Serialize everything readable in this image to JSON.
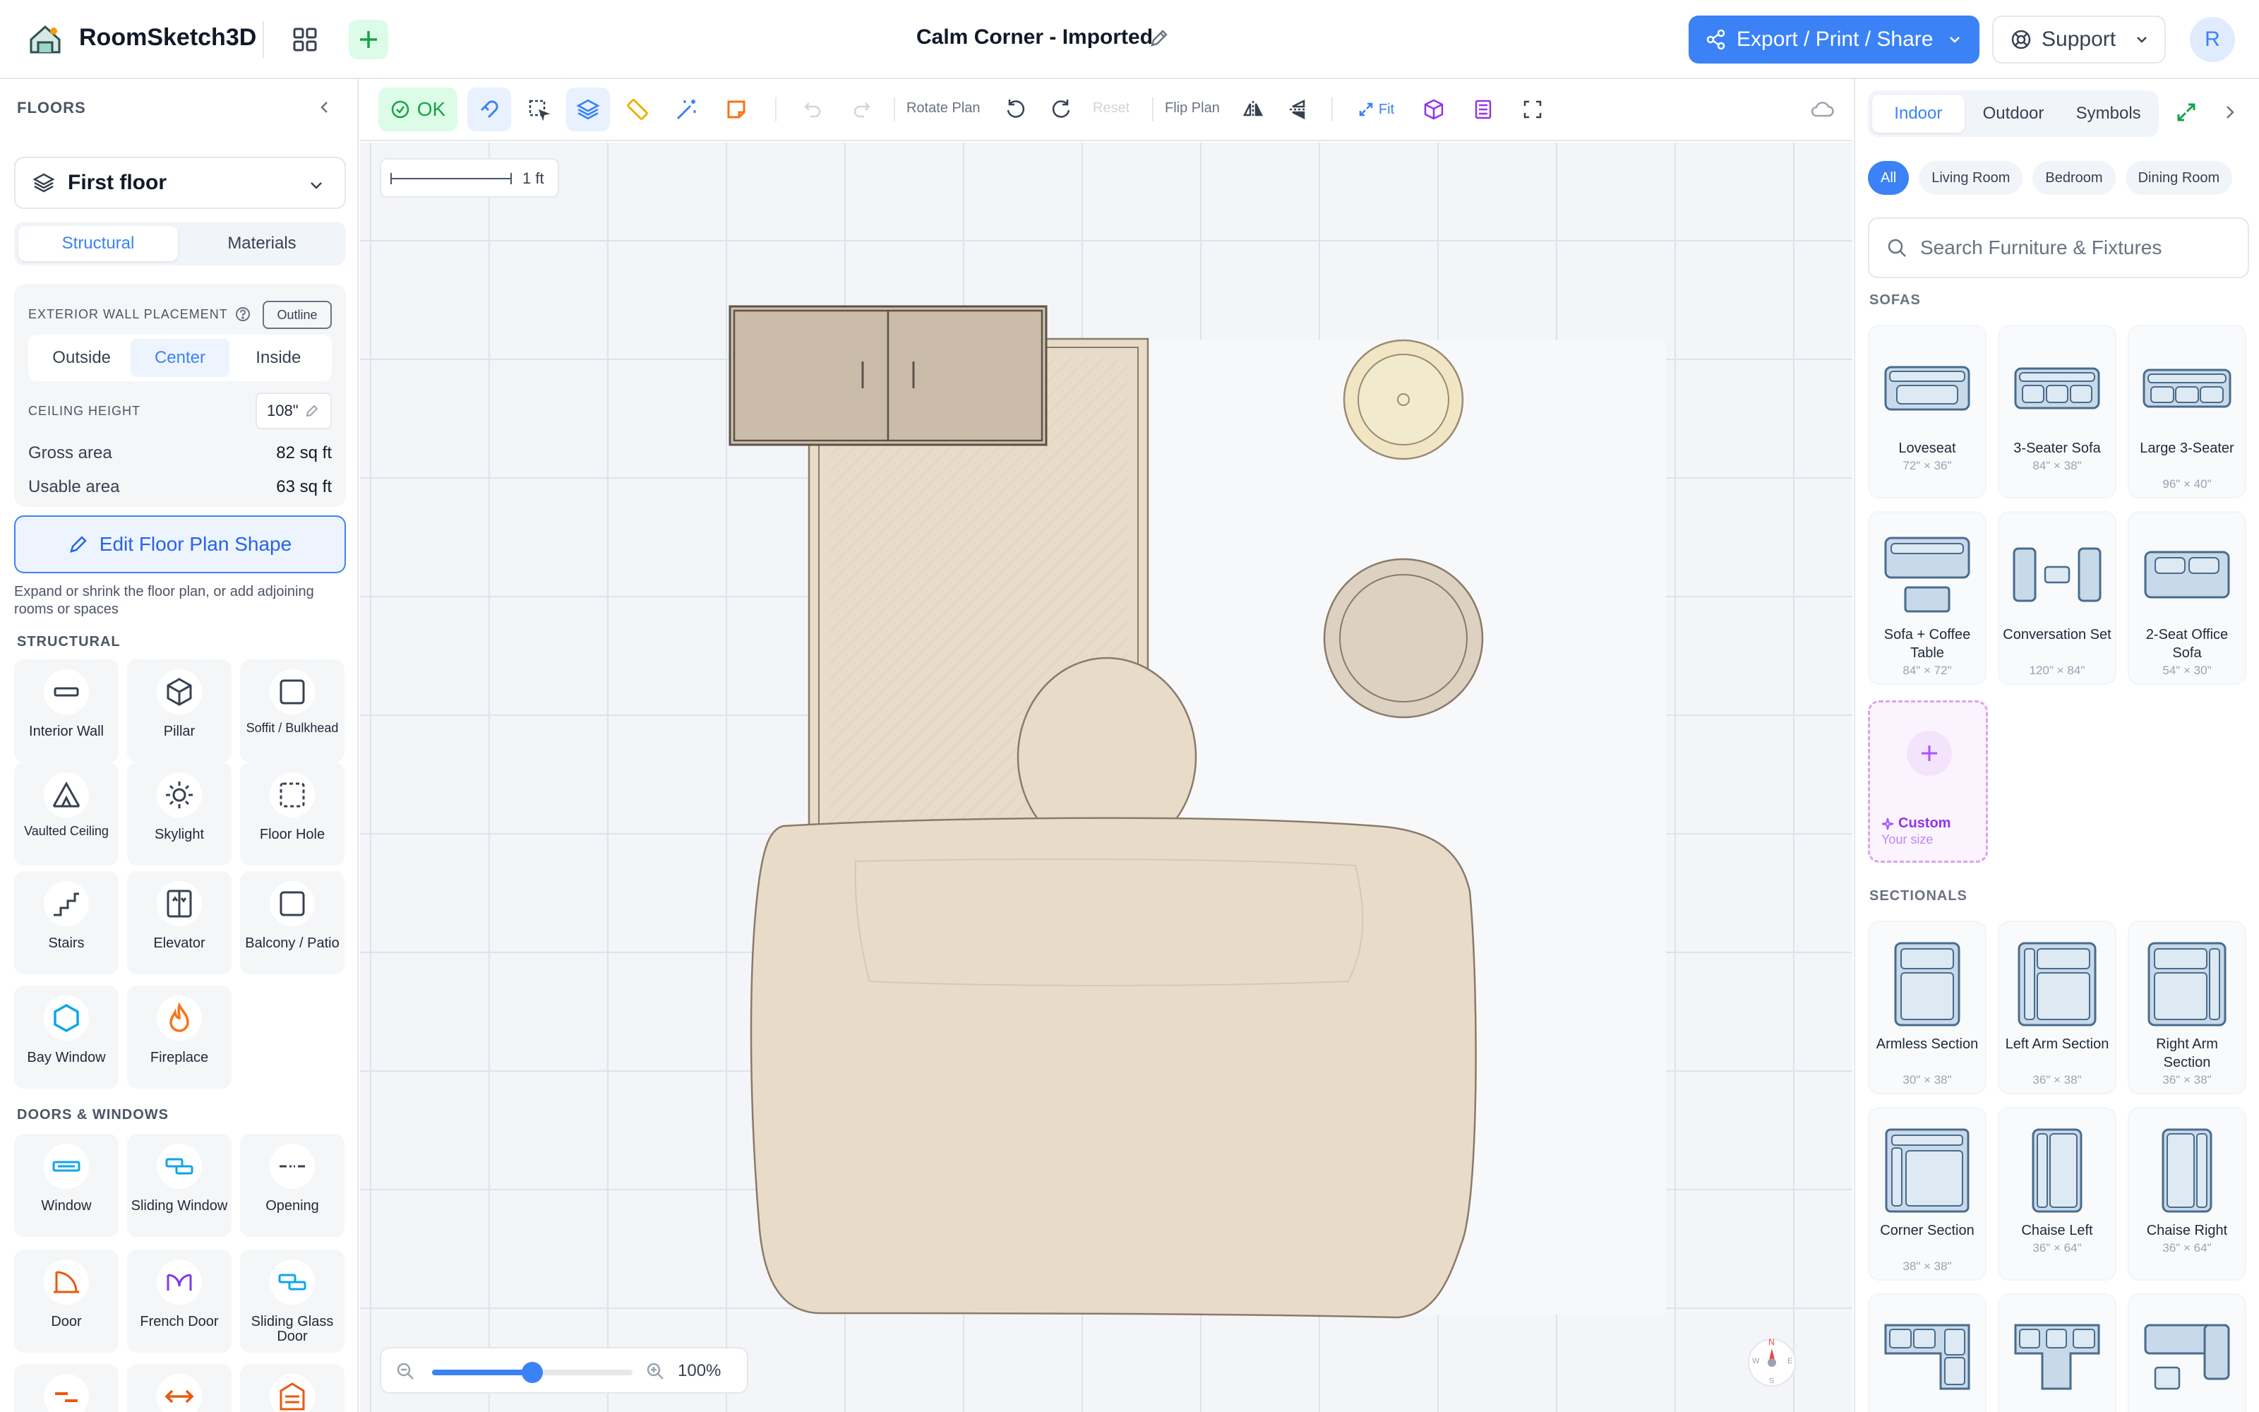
{
  "app": {
    "name": "RoomSketch3D",
    "logo_icon": "house-logo-icon",
    "grid_icon": "grid-icon",
    "add_icon": "plus-icon"
  },
  "document": {
    "title": "Calm Corner - Imported",
    "edit_icon": "pencil-icon"
  },
  "header": {
    "export_label": "Export / Print / Share",
    "support_label": "Support",
    "avatar_initial": "R"
  },
  "left_panel": {
    "heading": "FLOORS",
    "floor_selected": "First floor",
    "tabs": [
      "Structural",
      "Materials"
    ],
    "active_tab": "Structural",
    "wall_placement": {
      "label": "EXTERIOR WALL PLACEMENT",
      "outline_label": "Outline",
      "options": [
        "Outside",
        "Center",
        "Inside"
      ],
      "active": "Center"
    },
    "ceiling": {
      "label": "CEILING HEIGHT",
      "value": "108\""
    },
    "areas": [
      {
        "label": "Gross area",
        "value": "82 sq ft"
      },
      {
        "label": "Usable area",
        "value": "63 sq ft"
      }
    ],
    "edit_button": "Edit Floor Plan Shape",
    "edit_hint": "Expand or shrink the floor plan, or add adjoining rooms or spaces",
    "structural_heading": "STRUCTURAL",
    "structural_items": [
      {
        "label": "Interior Wall",
        "icon": "interior-wall-icon"
      },
      {
        "label": "Pillar",
        "icon": "pillar-icon"
      },
      {
        "label": "Soffit / Bulkhead",
        "icon": "soffit-icon"
      },
      {
        "label": "Vaulted Ceiling",
        "icon": "vaulted-ceiling-icon"
      },
      {
        "label": "Skylight",
        "icon": "skylight-icon"
      },
      {
        "label": "Floor Hole",
        "icon": "floor-hole-icon"
      },
      {
        "label": "Stairs",
        "icon": "stairs-icon"
      },
      {
        "label": "Elevator",
        "icon": "elevator-icon"
      },
      {
        "label": "Balcony / Patio",
        "icon": "balcony-icon"
      },
      {
        "label": "Bay Window",
        "icon": "bay-window-icon"
      },
      {
        "label": "Fireplace",
        "icon": "fireplace-icon"
      }
    ],
    "doors_heading": "DOORS & WINDOWS",
    "door_items": [
      {
        "label": "Window",
        "icon": "window-icon"
      },
      {
        "label": "Sliding Window",
        "icon": "sliding-window-icon"
      },
      {
        "label": "Opening",
        "icon": "opening-icon"
      },
      {
        "label": "Door",
        "icon": "door-icon"
      },
      {
        "label": "French Door",
        "icon": "french-door-icon"
      },
      {
        "label": "Sliding Glass Door",
        "icon": "sliding-glass-door-icon"
      }
    ]
  },
  "toolbar": {
    "ok_label": "OK",
    "rotate_label": "Rotate Plan",
    "reset_label": "Reset",
    "flip_label": "Flip Plan",
    "fit_label": "Fit"
  },
  "canvas": {
    "scale_label": "1 ft",
    "zoom_label": "100%",
    "zoom_fraction": 0.5,
    "compass_labels": {
      "n": "N",
      "e": "E",
      "s": "S",
      "w": "W"
    }
  },
  "right_panel": {
    "tabs": [
      "Indoor",
      "Outdoor",
      "Symbols"
    ],
    "active_tab": "Indoor",
    "chips": [
      "All",
      "Living Room",
      "Bedroom",
      "Dining Room"
    ],
    "active_chip": "All",
    "search_placeholder": "Search Furniture & Fixtures",
    "sofas_heading": "SOFAS",
    "sofas": [
      {
        "name": "Loveseat",
        "size": "72\" × 36\""
      },
      {
        "name": "3-Seater Sofa",
        "size": "84\" × 38\""
      },
      {
        "name": "Large 3-Seater",
        "size": "96\" × 40\""
      },
      {
        "name": "Sofa + Coffee Table",
        "size": "84\" × 72\""
      },
      {
        "name": "Conversation Set",
        "size": "120\" × 84\""
      },
      {
        "name": "2-Seat Office Sofa",
        "size": "54\" × 30\""
      }
    ],
    "custom": {
      "name": "Custom",
      "sub": "Your size"
    },
    "sectionals_heading": "SECTIONALS",
    "sectionals": [
      {
        "name": "Armless Section",
        "size": "30\" × 38\""
      },
      {
        "name": "Left Arm Section",
        "size": "36\" × 38\""
      },
      {
        "name": "Right Arm Section",
        "size": "36\" × 38\""
      },
      {
        "name": "Corner Section",
        "size": "38\" × 38\""
      },
      {
        "name": "Chaise Left",
        "size": "36\" × 64\""
      },
      {
        "name": "Chaise Right",
        "size": "36\" × 64\""
      }
    ]
  },
  "colors": {
    "accent": "#3b82f6",
    "ok_green": "#16a34a",
    "canvas_bg": "#f3f5f8",
    "room_fill": "#e8dcc9",
    "wall": "#8b7a6a",
    "purple": "#a855f7"
  }
}
